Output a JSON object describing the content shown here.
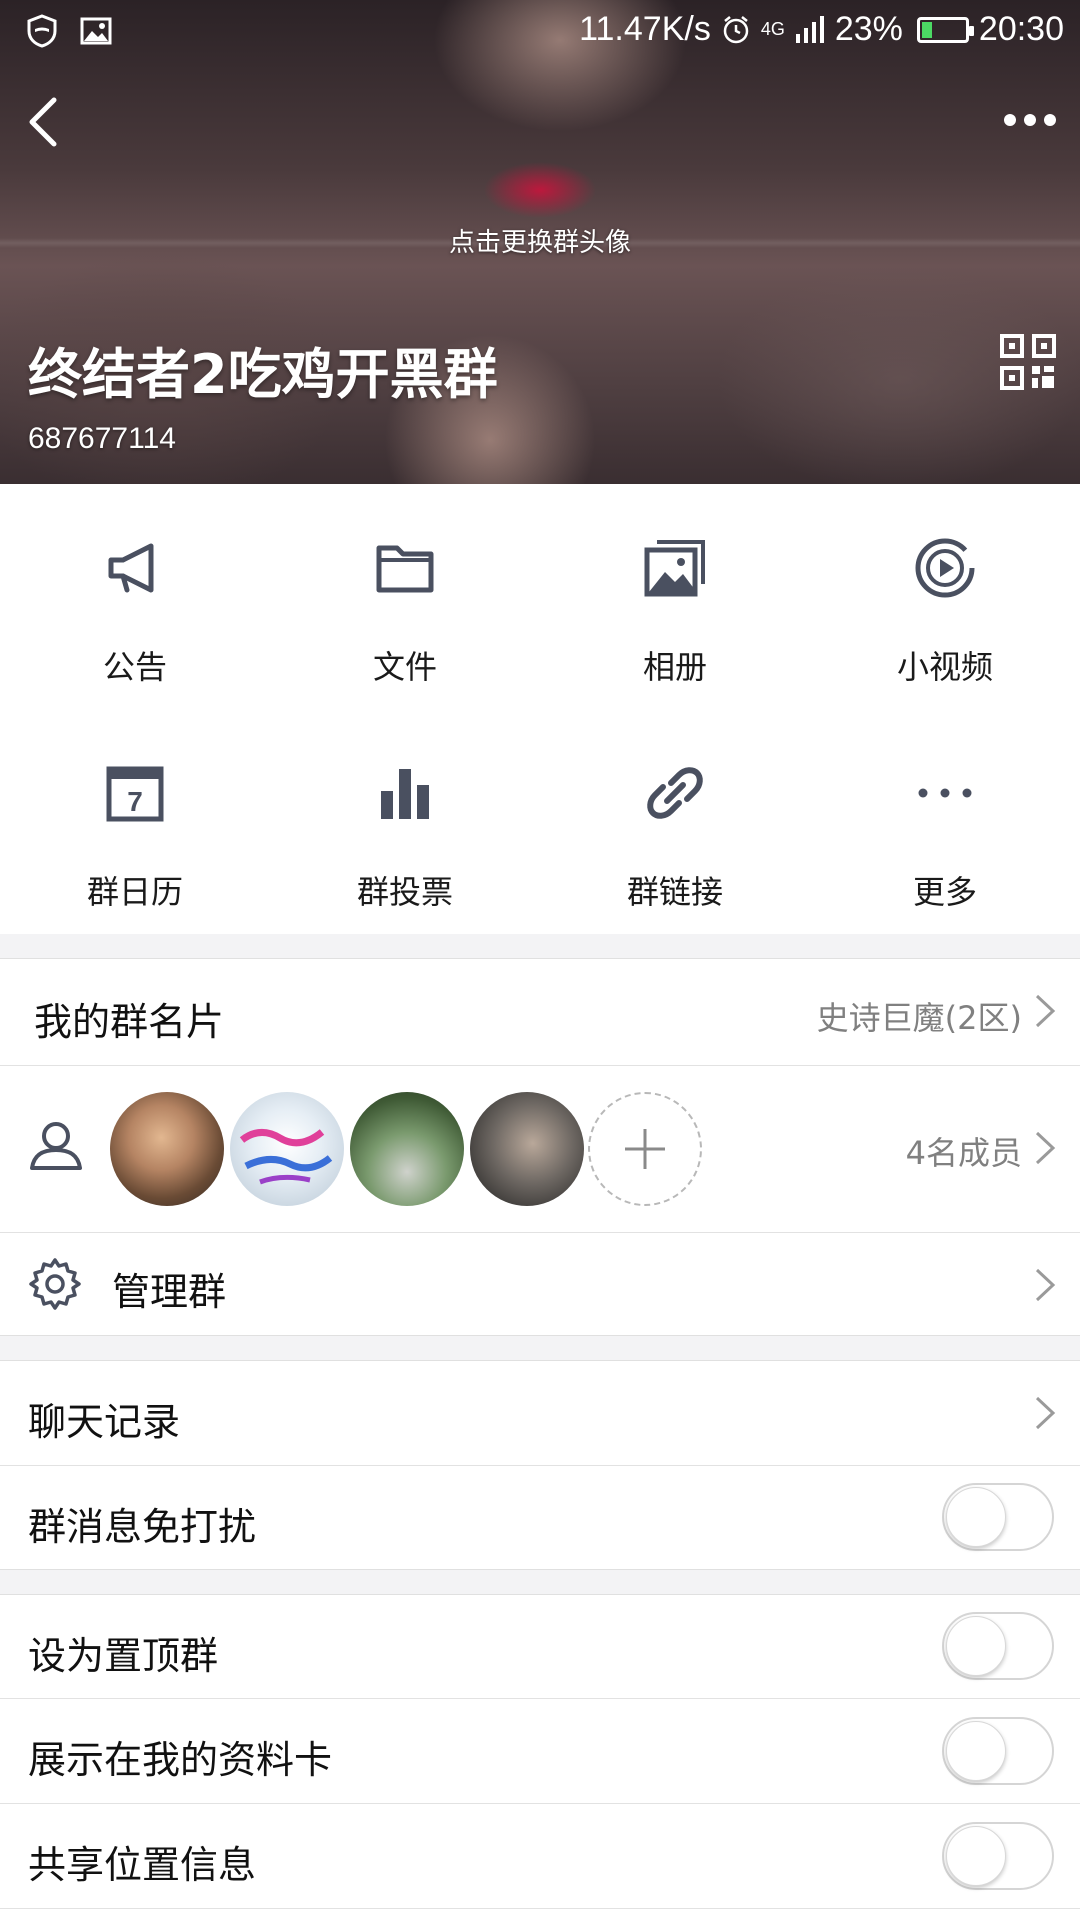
{
  "status_bar": {
    "net_speed": "11.47K/s",
    "network": "4G",
    "battery": "23%",
    "battery_level": 0.23,
    "time": "20:30"
  },
  "header": {
    "change_avatar_hint": "点击更换群头像",
    "group_name": "终结者2吃鸡开黑群",
    "group_id": "687677114"
  },
  "features": [
    {
      "label": "公告",
      "icon": "megaphone-icon"
    },
    {
      "label": "文件",
      "icon": "folder-icon"
    },
    {
      "label": "相册",
      "icon": "album-icon"
    },
    {
      "label": "小视频",
      "icon": "video-icon"
    },
    {
      "label": "群日历",
      "icon": "calendar-icon"
    },
    {
      "label": "群投票",
      "icon": "vote-icon"
    },
    {
      "label": "群链接",
      "icon": "link-icon"
    },
    {
      "label": "更多",
      "icon": "more-icon"
    }
  ],
  "calendar_day": "7",
  "group_card": {
    "label": "我的群名片",
    "value": "史诗巨魔(2区)"
  },
  "members": {
    "count_label": "4名成员"
  },
  "manage": {
    "label": "管理群"
  },
  "settings": {
    "chat_history": "聊天记录",
    "mute": {
      "label": "群消息免打扰",
      "on": false
    },
    "pin": {
      "label": "设为置顶群",
      "on": false
    },
    "show_on_profile": {
      "label": "展示在我的资料卡",
      "on": false
    },
    "share_location": {
      "label": "共享位置信息",
      "on": false
    }
  },
  "colors": {
    "icon": "#4a5060",
    "toggle_off": "#ffffff",
    "secondary_text": "#808080",
    "battery": "#4cd964"
  }
}
